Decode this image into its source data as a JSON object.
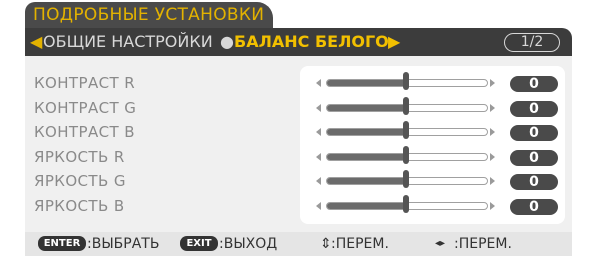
{
  "tab_title": "ПОДРОБНЫЕ УСТАНОВКИ",
  "header": {
    "left_arrow_icon": "triangle-left-icon",
    "general_label": "ОБЩИЕ НАСТРОЙКИ",
    "separator_icon": "bullet-dot-icon",
    "white_balance_label": "БАЛАНС БЕЛОГО",
    "right_arrow_icon": "triangle-right-icon",
    "page_indicator": "1/2"
  },
  "rows": [
    {
      "label": "КОНТРАСТ R",
      "value": "0",
      "level": 0.5
    },
    {
      "label": "КОНТРАСТ G",
      "value": "0",
      "level": 0.5
    },
    {
      "label": "КОНТРАСТ B",
      "value": "0",
      "level": 0.5
    },
    {
      "label": "ЯРКОСТЬ R",
      "value": "0",
      "level": 0.5
    },
    {
      "label": "ЯРКОСТЬ G",
      "value": "0",
      "level": 0.5
    },
    {
      "label": "ЯРКОСТЬ B",
      "value": "0",
      "level": 0.5
    }
  ],
  "footer": {
    "enter_key": "ENTER",
    "enter_text": ":ВЫБРАТЬ",
    "exit_key": "EXIT",
    "exit_text": ":ВЫХОД",
    "updown_icon": "up-down-arrows-icon",
    "updown_glyph": "⇕",
    "updown_text": ":ПЕРЕМ.",
    "leftright_icon": "left-right-arrows-icon",
    "leftright_glyph": "◂▸",
    "leftright_text": ":ПЕРЕМ."
  },
  "colors": {
    "accent": "#f2c000",
    "tab_bg": "#4a4a4a",
    "header_bg": "#3c3c3c",
    "panel_bg": "#f0f0f0",
    "label": "#8a8a8a",
    "value_bg": "#4a4a4a"
  }
}
